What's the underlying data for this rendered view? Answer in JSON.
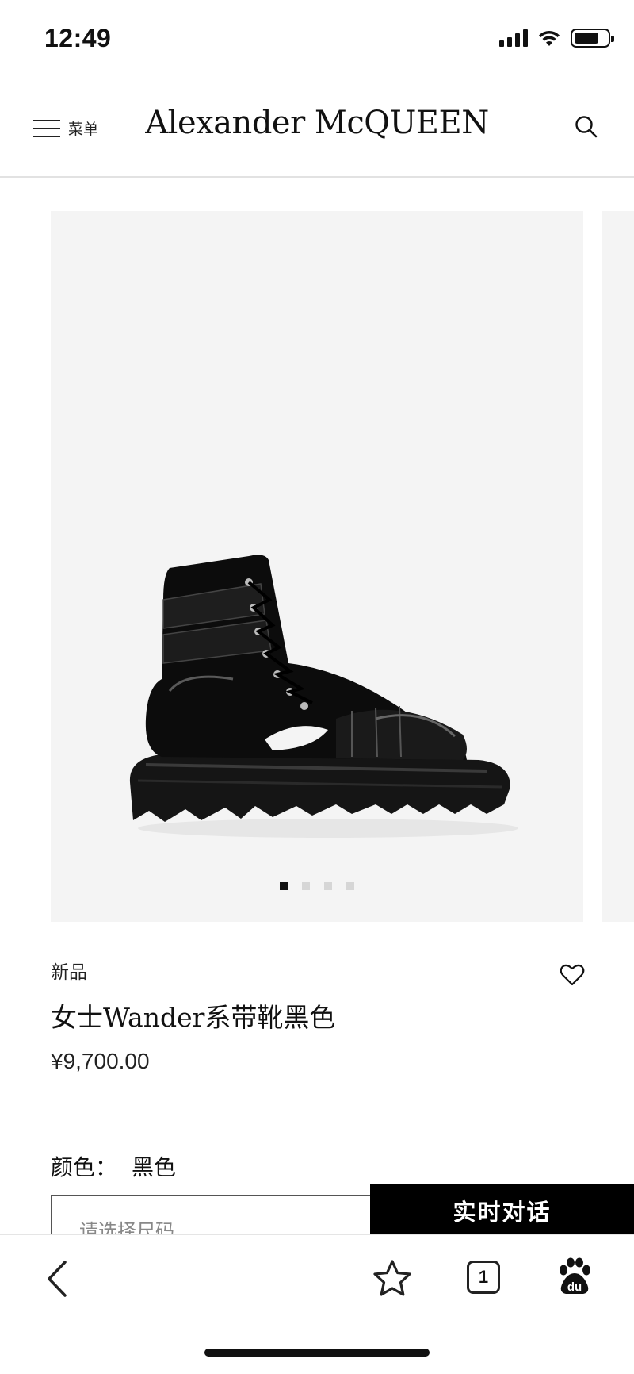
{
  "status_bar": {
    "time": "12:49"
  },
  "header": {
    "menu_label": "菜单",
    "logo": "Alexander McQUEEN"
  },
  "gallery": {
    "slide_count": 4,
    "active_index": 0
  },
  "product": {
    "badge": "新品",
    "name": "女士Wander系带靴黑色",
    "price": "¥9,700.00",
    "color_label": "颜色：",
    "color_value": "黑色",
    "size_placeholder": "请选择尺码"
  },
  "chat_button": {
    "label": "实时对话"
  },
  "browser_bar": {
    "tab_count": "1"
  },
  "icons": [
    "menu-icon",
    "search-icon",
    "heart-icon",
    "back-icon",
    "star-icon",
    "tabs-icon",
    "baidu-paw-icon"
  ]
}
